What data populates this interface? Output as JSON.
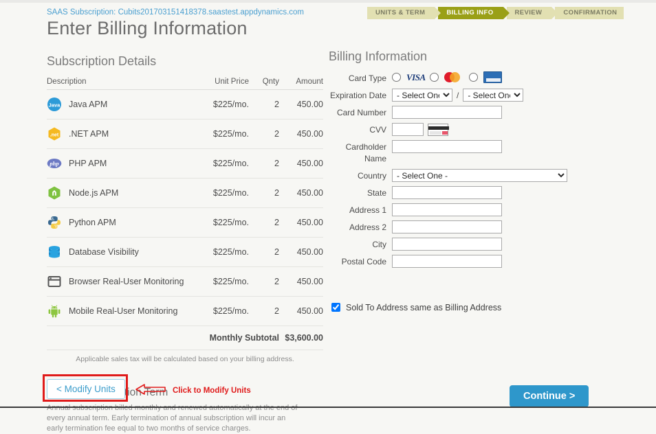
{
  "header": {
    "saas_label": "SAAS Subscription:",
    "saas_value": "Cubits201703151418378.saastest.appdynamics.com",
    "page_title": "Enter Billing Information"
  },
  "steps": [
    {
      "label": "UNITS & TERM",
      "active": false
    },
    {
      "label": "BILLING INFO",
      "active": true
    },
    {
      "label": "REVIEW",
      "active": false
    },
    {
      "label": "CONFIRMATION",
      "active": false
    }
  ],
  "subscription": {
    "section_title": "Subscription Details",
    "columns": {
      "description": "Description",
      "unit_price": "Unit Price",
      "qnty": "Qnty",
      "amount": "Amount"
    },
    "rows": [
      {
        "icon": "java-icon",
        "description": "Java APM",
        "unit_price": "$225/mo.",
        "qnty": "2",
        "amount": "450.00"
      },
      {
        "icon": "dotnet-icon",
        "description": ".NET APM",
        "unit_price": "$225/mo.",
        "qnty": "2",
        "amount": "450.00"
      },
      {
        "icon": "php-icon",
        "description": "PHP APM",
        "unit_price": "$225/mo.",
        "qnty": "2",
        "amount": "450.00"
      },
      {
        "icon": "nodejs-icon",
        "description": "Node.js APM",
        "unit_price": "$225/mo.",
        "qnty": "2",
        "amount": "450.00"
      },
      {
        "icon": "python-icon",
        "description": "Python APM",
        "unit_price": "$225/mo.",
        "qnty": "2",
        "amount": "450.00"
      },
      {
        "icon": "database-icon",
        "description": "Database Visibility",
        "unit_price": "$225/mo.",
        "qnty": "2",
        "amount": "450.00"
      },
      {
        "icon": "browser-icon",
        "description": "Browser Real-User Monitoring",
        "unit_price": "$225/mo.",
        "qnty": "2",
        "amount": "450.00"
      },
      {
        "icon": "android-icon",
        "description": "Mobile Real-User Monitoring",
        "unit_price": "$225/mo.",
        "qnty": "2",
        "amount": "450.00"
      }
    ],
    "subtotal_label": "Monthly Subtotal",
    "subtotal_value": "$3,600.00",
    "tax_note": "Applicable sales tax will be calculated based on your billing address."
  },
  "term": {
    "title": "Annual Subscription Term",
    "body": "Annual subscription billed monthly and renewed automatically at the end of every annual term. Early termination of annual subscription will incur an early termination fee equal to two months of service charges.",
    "modify_button": "< Modify Units"
  },
  "annotation": {
    "text": "Click to Modify Units",
    "color": "#e01b1b"
  },
  "billing": {
    "section_title": "Billing Information",
    "labels": {
      "card_type": "Card Type",
      "expiration_date": "Expiration Date",
      "card_number": "Card Number",
      "cvv": "CVV",
      "cardholder_name": "Cardholder Name",
      "country": "Country",
      "state": "State",
      "address1": "Address 1",
      "address2": "Address 2",
      "city": "City",
      "postal_code": "Postal Code"
    },
    "card_types": [
      {
        "name": "visa-logo",
        "label": "VISA",
        "selected": false
      },
      {
        "name": "mastercard-logo",
        "label": "MasterCard",
        "selected": false
      },
      {
        "name": "amex-logo",
        "label": "American Express",
        "selected": false
      }
    ],
    "expiration_month": "- Select One -",
    "expiration_year": "- Select One -",
    "separator": "/",
    "country_value": "- Select One -",
    "values": {
      "card_number": "",
      "cvv": "",
      "cardholder_name": "",
      "state": "",
      "address1": "",
      "address2": "",
      "city": "",
      "postal_code": ""
    },
    "sold_to_checkbox": {
      "label": "Sold To Address same as Billing Address",
      "checked": true
    }
  },
  "footer": {
    "continue_label": "Continue >",
    "continue_color": "#2e97cb"
  }
}
